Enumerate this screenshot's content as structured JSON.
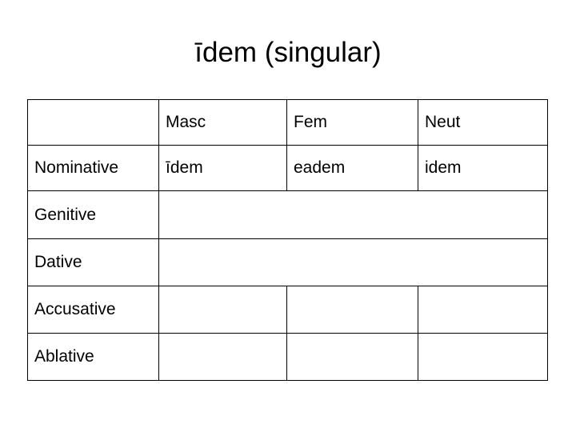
{
  "slide": {
    "title": "īdem (singular)",
    "background_color": "#ffffff"
  },
  "colors": {
    "masculine_form": "#b01f24",
    "feminine_form": "#373769",
    "neuter_form": "#b01f24",
    "text": "#000000",
    "border": "#000000"
  },
  "table": {
    "corner_label": "",
    "column_headers": [
      "Masc",
      "Fem",
      "Neut"
    ],
    "rows": [
      {
        "case": "Nominative",
        "masc": "īdem",
        "fem": "eadem",
        "neut": "idem",
        "merged": false
      },
      {
        "case": "Genitive",
        "masc": "",
        "fem": "",
        "neut": "",
        "merged": true
      },
      {
        "case": "Dative",
        "masc": "",
        "fem": "",
        "neut": "",
        "merged": true
      },
      {
        "case": "Accusative",
        "masc": "",
        "fem": "",
        "neut": "",
        "merged": false
      },
      {
        "case": "Ablative",
        "masc": "",
        "fem": "",
        "neut": "",
        "merged": false
      }
    ]
  }
}
